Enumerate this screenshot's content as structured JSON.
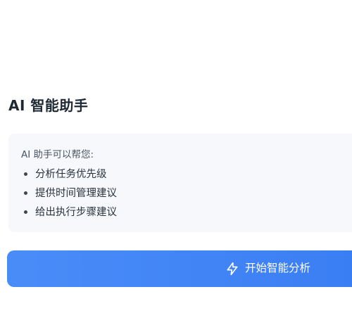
{
  "assistant": {
    "title": "AI 智能助手",
    "intro": "AI 助手可以帮您:",
    "features": [
      "分析任务优先级",
      "提供时间管理建议",
      "给出执行步骤建议"
    ]
  },
  "action": {
    "label": "开始智能分析",
    "icon": "sparkle-icon",
    "color": "#3f83f6"
  }
}
